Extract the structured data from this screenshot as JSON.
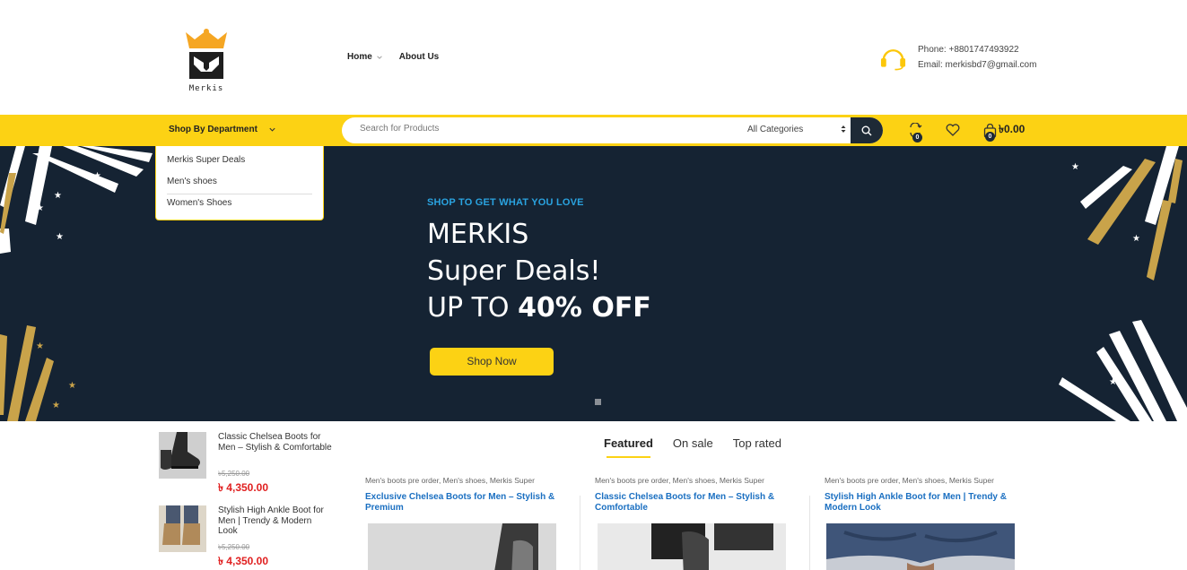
{
  "header": {
    "logo_text": "Merkis",
    "nav": [
      {
        "label": "Home"
      },
      {
        "label": "About Us"
      }
    ],
    "contact": {
      "phone": "Phone: +8801747493922",
      "email": "Email: merkisbd7@gmail.com"
    }
  },
  "toolbar": {
    "department_label": "Shop By Department",
    "search_placeholder": "Search for Products",
    "category_select": "All Categories",
    "compare_count": "0",
    "wishlist_icon": "heart-icon",
    "cart_count": "0",
    "cart_total": "৳0.00"
  },
  "department_menu": [
    {
      "label": "Merkis Super Deals"
    },
    {
      "label": "Men's shoes"
    },
    {
      "label": "Women's Shoes"
    }
  ],
  "hero": {
    "tagline": "SHOP TO GET WHAT YOU LOVE",
    "line1": "MERKIS",
    "line2": "Super Deals!",
    "line3_prefix": "UP TO ",
    "line3_bold": "40% OFF",
    "button": "Shop Now"
  },
  "side_products": [
    {
      "name": "Classic Chelsea Boots for Men – Stylish & Comfortable",
      "old_price": "৳5,250.00",
      "price": "৳ 4,350.00"
    },
    {
      "name": "Stylish High Ankle Boot for Men | Trendy & Modern Look",
      "old_price": "৳5,250.00",
      "price": "৳ 4,350.00"
    }
  ],
  "tabs": [
    {
      "label": "Featured",
      "active": true
    },
    {
      "label": "On sale",
      "active": false
    },
    {
      "label": "Top rated",
      "active": false
    }
  ],
  "products": [
    {
      "categories": "Men's boots pre order, Men's shoes, Merkis Super",
      "title": "Exclusive Chelsea Boots for Men – Stylish & Premium"
    },
    {
      "categories": "Men's boots pre order, Men's shoes, Merkis Super",
      "title": "Classic Chelsea Boots for Men – Stylish & Comfortable"
    },
    {
      "categories": "Men's boots pre order, Men's shoes, Merkis Super",
      "title": "Stylish High Ankle Boot for Men | Trendy & Modern Look"
    }
  ],
  "colors": {
    "accent": "#fcd214",
    "hero_bg": "#152333",
    "price": "#e02020",
    "link": "#1a6fc1"
  }
}
